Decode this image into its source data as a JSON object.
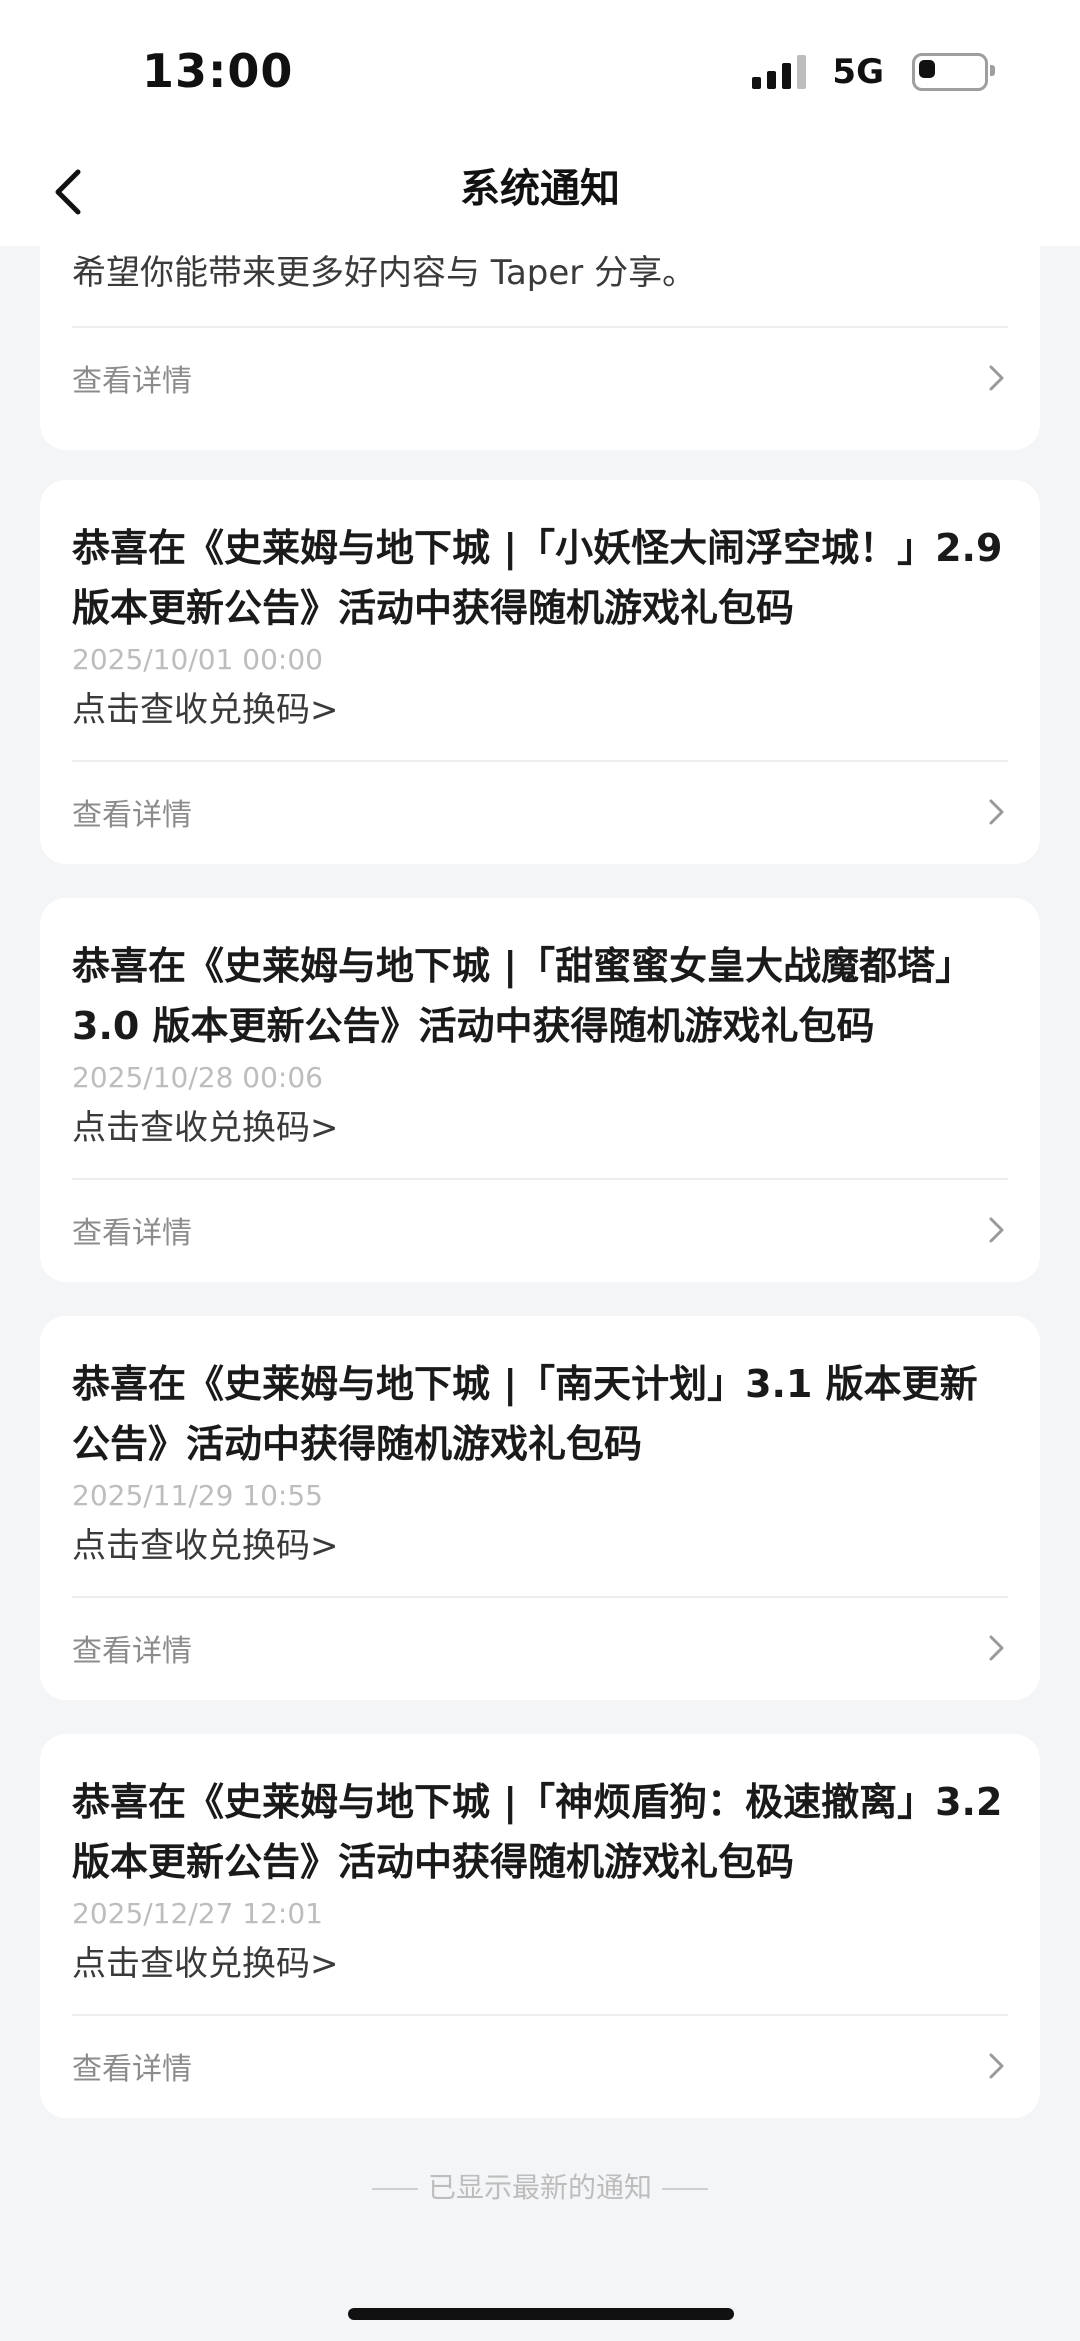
{
  "status_bar": {
    "time": "13:00",
    "network": "5G"
  },
  "header": {
    "title": "系统通知"
  },
  "partial_card": {
    "body": "希望你能带来更多好内容与 Taper 分享。",
    "detail_label": "查看详情"
  },
  "notifications": [
    {
      "title": "恭喜在《史莱姆与地下城 |「小妖怪大闹浮空城！」2.9 版本更新公告》活动中获得随机游戏礼包码",
      "date": "2025/10/01 00:00",
      "body": "点击查收兑换码>",
      "detail_label": "查看详情"
    },
    {
      "title": "恭喜在《史莱姆与地下城 |「甜蜜蜜女皇大战魔都塔」3.0 版本更新公告》活动中获得随机游戏礼包码",
      "date": "2025/10/28 00:06",
      "body": "点击查收兑换码>",
      "detail_label": "查看详情"
    },
    {
      "title": "恭喜在《史莱姆与地下城 |「南天计划」3.1 版本更新公告》活动中获得随机游戏礼包码",
      "date": "2025/11/29 10:55",
      "body": "点击查收兑换码>",
      "detail_label": "查看详情"
    },
    {
      "title": "恭喜在《史莱姆与地下城 |「神烦盾狗：极速撤离」3.2 版本更新公告》活动中获得随机游戏礼包码",
      "date": "2025/12/27 12:01",
      "body": "点击查收兑换码>",
      "detail_label": "查看详情"
    }
  ],
  "footer": {
    "end_text": "已显示最新的通知"
  }
}
